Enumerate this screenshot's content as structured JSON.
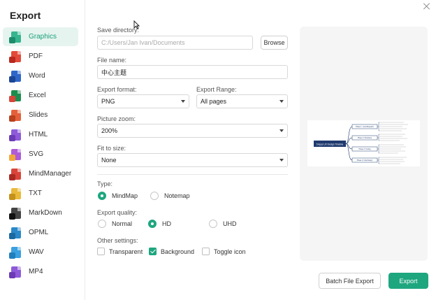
{
  "sidebar": {
    "title": "Export",
    "items": [
      {
        "label": "Graphics",
        "color": "#36b58e",
        "active": true
      },
      {
        "label": "PDF",
        "color": "#e2493a"
      },
      {
        "label": "Word",
        "color": "#2f66c9"
      },
      {
        "label": "Excel",
        "color": "#1e8c4e"
      },
      {
        "label": "Slides",
        "color": "#e3603a"
      },
      {
        "label": "HTML",
        "color": "#8e5ad9"
      },
      {
        "label": "SVG",
        "color": "#b05bd8"
      },
      {
        "label": "MindManager",
        "color": "#d9443a"
      },
      {
        "label": "TXT",
        "color": "#e9b93a"
      },
      {
        "label": "MarkDown",
        "color": "#333333"
      },
      {
        "label": "OPML",
        "color": "#2b88c9"
      },
      {
        "label": "WAV",
        "color": "#3aa0e0"
      },
      {
        "label": "MP4",
        "color": "#8e5ad9"
      }
    ]
  },
  "form": {
    "save_dir_label": "Save directory:",
    "save_dir_placeholder": "C:/Users/Jan Ivan/Documents",
    "browse": "Browse",
    "file_name_label": "File name:",
    "file_name_value": "中心主题",
    "export_format_label": "Export format:",
    "export_format_value": "PNG",
    "export_range_label": "Export Range:",
    "export_range_value": "All pages",
    "picture_zoom_label": "Picture zoom:",
    "picture_zoom_value": "200%",
    "fit_label": "Fit to size:",
    "fit_value": "None",
    "type_label": "Type:",
    "type_options": [
      "MindMap",
      "Notemap"
    ],
    "type_selected": "MindMap",
    "quality_label": "Export quality:",
    "quality_options": [
      "Normal",
      "HD",
      "UHD"
    ],
    "quality_selected": "HD",
    "other_label": "Other settings:",
    "other_options": [
      {
        "label": "Transparent",
        "checked": false
      },
      {
        "label": "Background",
        "checked": true
      },
      {
        "label": "Toggle icon",
        "checked": false
      }
    ]
  },
  "footer": {
    "batch": "Batch File Export",
    "export": "Export"
  },
  "preview": {
    "central_topic": "5 Apps UX Design Timeline",
    "branches": [
      "Phase 1: Local Research",
      "Phase 2: Wireframe",
      "Phase 3: Testing",
      "Phase 4: Final Design"
    ]
  },
  "colors": {
    "accent": "#1ea67f"
  }
}
